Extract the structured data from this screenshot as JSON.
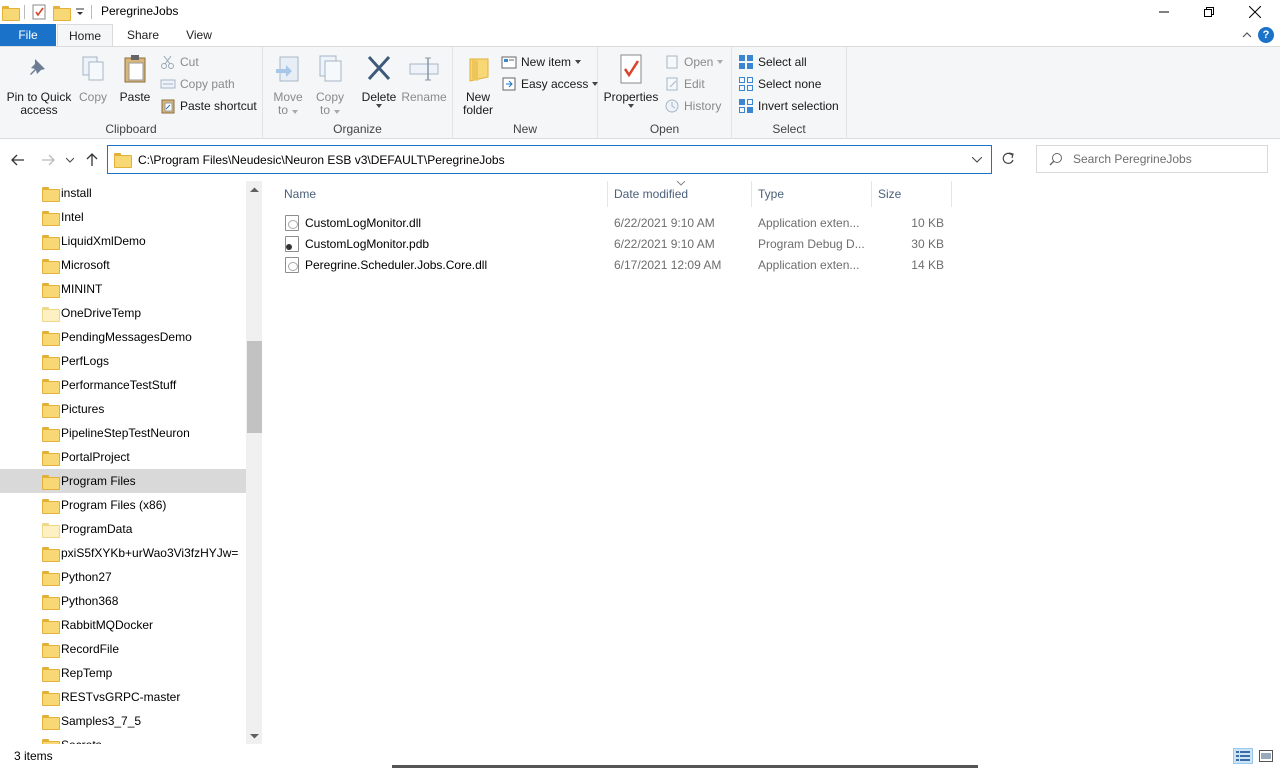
{
  "window": {
    "title": "PeregrineJobs",
    "controls": {
      "minimize": "minimize-icon",
      "maximize": "restore-icon",
      "close": "close-icon"
    }
  },
  "ribbon_tabs": {
    "file": "File",
    "home": "Home",
    "share": "Share",
    "view": "View"
  },
  "ribbon": {
    "clipboard": {
      "label": "Clipboard",
      "pin_line1": "Pin to Quick",
      "pin_line2": "access",
      "copy": "Copy",
      "paste": "Paste",
      "cut": "Cut",
      "copy_path": "Copy path",
      "paste_shortcut": "Paste shortcut"
    },
    "organize": {
      "label": "Organize",
      "move_to_line1": "Move",
      "move_to_line2": "to",
      "copy_to_line1": "Copy",
      "copy_to_line2": "to",
      "delete": "Delete",
      "rename": "Rename"
    },
    "new": {
      "label": "New",
      "new_folder_line1": "New",
      "new_folder_line2": "folder",
      "new_item": "New item",
      "easy_access": "Easy access"
    },
    "open": {
      "label": "Open",
      "properties": "Properties",
      "open": "Open",
      "edit": "Edit",
      "history": "History"
    },
    "select": {
      "label": "Select",
      "select_all": "Select all",
      "select_none": "Select none",
      "invert_selection": "Invert selection"
    }
  },
  "address": {
    "path": "C:\\Program Files\\Neudesic\\Neuron ESB v3\\DEFAULT\\PeregrineJobs",
    "search_placeholder": "Search PeregrineJobs"
  },
  "nav_pane": {
    "items": [
      {
        "label": "install",
        "light": false,
        "selected": false
      },
      {
        "label": "Intel",
        "light": false,
        "selected": false
      },
      {
        "label": "LiquidXmlDemo",
        "light": false,
        "selected": false
      },
      {
        "label": "Microsoft",
        "light": false,
        "selected": false
      },
      {
        "label": "MININT",
        "light": false,
        "selected": false
      },
      {
        "label": "OneDriveTemp",
        "light": true,
        "selected": false
      },
      {
        "label": "PendingMessagesDemo",
        "light": false,
        "selected": false
      },
      {
        "label": "PerfLogs",
        "light": false,
        "selected": false
      },
      {
        "label": "PerformanceTestStuff",
        "light": false,
        "selected": false
      },
      {
        "label": "Pictures",
        "light": false,
        "selected": false
      },
      {
        "label": "PipelineStepTestNeuron",
        "light": false,
        "selected": false
      },
      {
        "label": "PortalProject",
        "light": false,
        "selected": false
      },
      {
        "label": "Program Files",
        "light": false,
        "selected": true
      },
      {
        "label": "Program Files (x86)",
        "light": false,
        "selected": false
      },
      {
        "label": "ProgramData",
        "light": true,
        "selected": false
      },
      {
        "label": "pxiS5fXYKb+urWao3Vi3fzHYJw=",
        "light": false,
        "selected": false
      },
      {
        "label": "Python27",
        "light": false,
        "selected": false
      },
      {
        "label": "Python368",
        "light": false,
        "selected": false
      },
      {
        "label": "RabbitMQDocker",
        "light": false,
        "selected": false
      },
      {
        "label": "RecordFile",
        "light": false,
        "selected": false
      },
      {
        "label": "RepTemp",
        "light": false,
        "selected": false
      },
      {
        "label": "RESTvsGRPC-master",
        "light": false,
        "selected": false
      },
      {
        "label": "Samples3_7_5",
        "light": false,
        "selected": false
      },
      {
        "label": "Secrets",
        "light": false,
        "selected": false
      }
    ]
  },
  "file_list": {
    "columns": {
      "name": "Name",
      "date": "Date modified",
      "type": "Type",
      "size": "Size"
    },
    "rows": [
      {
        "name": "CustomLogMonitor.dll",
        "date": "6/22/2021 9:10 AM",
        "type": "Application exten...",
        "size": "10 KB",
        "icon": "dll-file-icon"
      },
      {
        "name": "CustomLogMonitor.pdb",
        "date": "6/22/2021 9:10 AM",
        "type": "Program Debug D...",
        "size": "30 KB",
        "icon": "pdb-file-icon"
      },
      {
        "name": "Peregrine.Scheduler.Jobs.Core.dll",
        "date": "6/17/2021 12:09 AM",
        "type": "Application exten...",
        "size": "14 KB",
        "icon": "dll-file-icon"
      }
    ]
  },
  "status": {
    "item_count": "3 items"
  },
  "colors": {
    "accent": "#1a73c9",
    "ribbon_bg": "#f5f6f7",
    "selected_bg": "#d9d9d9",
    "folder": "#f8d775"
  }
}
